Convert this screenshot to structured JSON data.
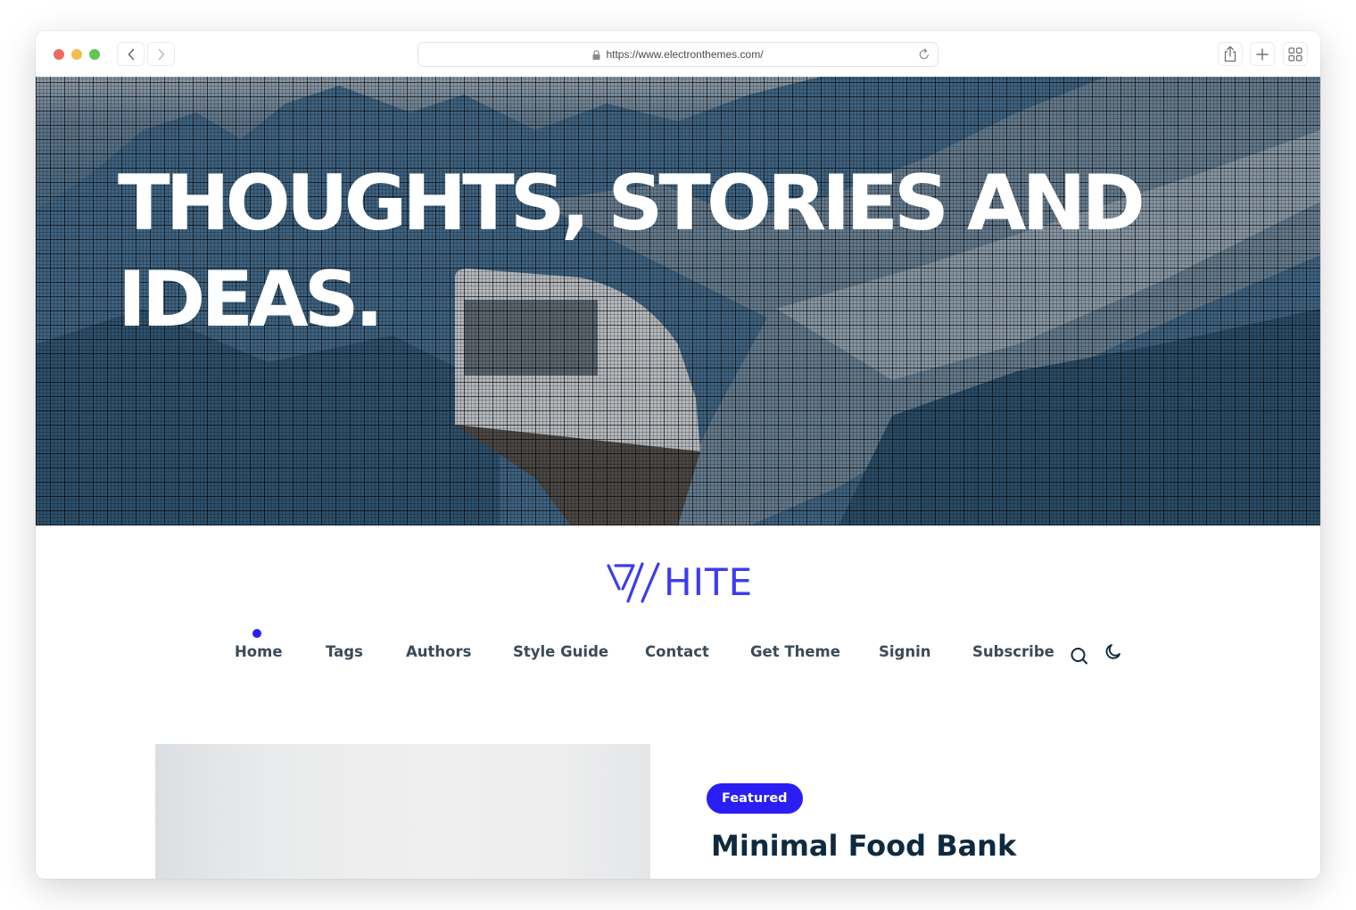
{
  "browser": {
    "url": "https://www.electronthemes.com/",
    "icons": {
      "back": "chevron-left-icon",
      "forward": "chevron-right-icon",
      "lock": "lock-icon",
      "reload": "reload-icon",
      "share": "share-icon",
      "new_tab": "plus-icon",
      "tab_overview": "grid-icon"
    }
  },
  "hero": {
    "title": "Thoughts, stories and ideas."
  },
  "site": {
    "logo_text": "HITE",
    "logo_icon": "w-mark-icon"
  },
  "nav": {
    "active_index": 0,
    "items": [
      {
        "label": "Home"
      },
      {
        "label": "Tags"
      },
      {
        "label": "Authors"
      },
      {
        "label": "Style Guide"
      },
      {
        "label": "Contact"
      },
      {
        "label": "Get Theme"
      },
      {
        "label": "Signin"
      },
      {
        "label": "Subscribe"
      }
    ],
    "search_icon": "search-icon",
    "theme_toggle_icon": "moon-icon"
  },
  "featured_post": {
    "badge": "Featured",
    "title": "Minimal Food Bank"
  },
  "colors": {
    "accent": "#2a1ef5",
    "logo": "#3c3cf0",
    "nav_text": "#3b4a57",
    "heading": "#0e2a40"
  }
}
